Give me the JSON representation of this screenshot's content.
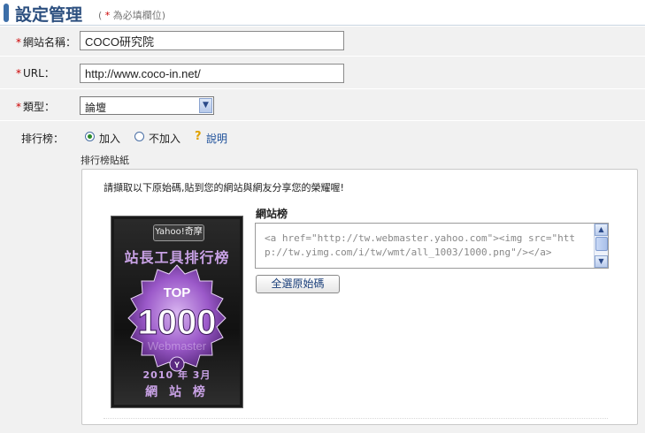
{
  "header": {
    "title": "設定管理",
    "required_note_prefix": "(",
    "required_note_star": "*",
    "required_note_text": "為必填欄位)"
  },
  "form": {
    "required_marker": "*",
    "site_name": {
      "label": "網站名稱：",
      "value": "COCO研究院"
    },
    "url": {
      "label": "URL：",
      "value": "http://www.coco-in.net/"
    },
    "type": {
      "label": "類型：",
      "selected": "論壇"
    },
    "ranking": {
      "label": "排行榜：",
      "options": [
        {
          "label": "加入",
          "checked": true
        },
        {
          "label": "不加入",
          "checked": false
        }
      ],
      "help_label": "說明"
    }
  },
  "sticker": {
    "section_label": "排行榜貼紙",
    "intro": "請擷取以下原始碼,貼到您的網站與網友分享您的榮耀喔!",
    "badge": {
      "brand": "Yahoo!奇摩",
      "title": "站長工具排行榜",
      "rank_label": "TOP",
      "rank_value": "1000",
      "watermark": "Webmaster",
      "date": "2010 年 3月",
      "footer": "網 站 榜"
    },
    "code_title": "網站榜",
    "code": "<a href=\"http://tw.webmaster.yahoo.com\"><img src=\"http://tw.yimg.com/i/tw/wmt/all_1003/1000.png\"/></a>",
    "select_all_label": "全選原始碼"
  },
  "colors": {
    "accent": "#3c6ea8",
    "required": "#cc0000",
    "badge_purple": "#9b59c9"
  },
  "icons": {
    "header": "blue-bar-icon",
    "help": "question-mark-icon",
    "select_arrow": "chevron-down-icon"
  }
}
